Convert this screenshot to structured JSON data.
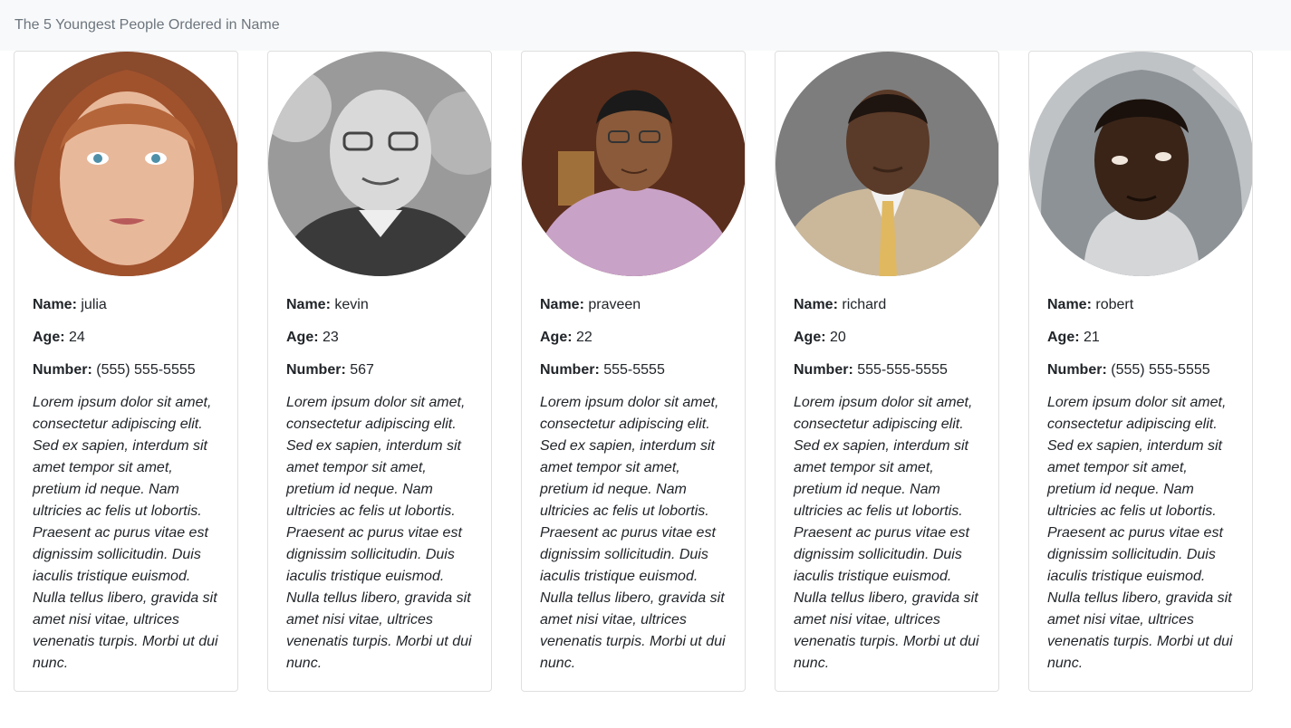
{
  "header": {
    "title": "The 5 Youngest People Ordered in Name"
  },
  "labels": {
    "name": "Name:",
    "age": "Age:",
    "number": "Number:"
  },
  "people": [
    {
      "name": "julia",
      "age": "24",
      "number": "(555) 555-5555",
      "bio": "Lorem ipsum dolor sit amet, consectetur adipiscing elit. Sed ex sapien, interdum sit amet tempor sit amet, pretium id neque. Nam ultricies ac felis ut lobortis. Praesent ac purus vitae est dignissim sollicitudin. Duis iaculis tristique euismod. Nulla tellus libero, gravida sit amet nisi vitae, ultrices venenatis turpis. Morbi ut dui nunc."
    },
    {
      "name": "kevin",
      "age": "23",
      "number": "567",
      "bio": "Lorem ipsum dolor sit amet, consectetur adipiscing elit. Sed ex sapien, interdum sit amet tempor sit amet, pretium id neque. Nam ultricies ac felis ut lobortis. Praesent ac purus vitae est dignissim sollicitudin. Duis iaculis tristique euismod. Nulla tellus libero, gravida sit amet nisi vitae, ultrices venenatis turpis. Morbi ut dui nunc."
    },
    {
      "name": "praveen",
      "age": "22",
      "number": "555-5555",
      "bio": "Lorem ipsum dolor sit amet, consectetur adipiscing elit. Sed ex sapien, interdum sit amet tempor sit amet, pretium id neque. Nam ultricies ac felis ut lobortis. Praesent ac purus vitae est dignissim sollicitudin. Duis iaculis tristique euismod. Nulla tellus libero, gravida sit amet nisi vitae, ultrices venenatis turpis. Morbi ut dui nunc."
    },
    {
      "name": "richard",
      "age": "20",
      "number": "555-555-5555",
      "bio": "Lorem ipsum dolor sit amet, consectetur adipiscing elit. Sed ex sapien, interdum sit amet tempor sit amet, pretium id neque. Nam ultricies ac felis ut lobortis. Praesent ac purus vitae est dignissim sollicitudin. Duis iaculis tristique euismod. Nulla tellus libero, gravida sit amet nisi vitae, ultrices venenatis turpis. Morbi ut dui nunc."
    },
    {
      "name": "robert",
      "age": "21",
      "number": "(555) 555-5555",
      "bio": "Lorem ipsum dolor sit amet, consectetur adipiscing elit. Sed ex sapien, interdum sit amet tempor sit amet, pretium id neque. Nam ultricies ac felis ut lobortis. Praesent ac purus vitae est dignissim sollicitudin. Duis iaculis tristique euismod. Nulla tellus libero, gravida sit amet nisi vitae, ultrices venenatis turpis. Morbi ut dui nunc."
    }
  ]
}
